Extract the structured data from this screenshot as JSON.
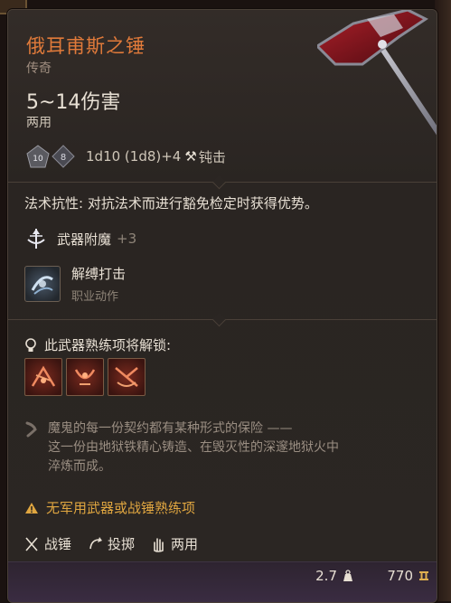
{
  "item": {
    "name": "俄耳甫斯之锤",
    "rarity": "传奇",
    "damage": "5~14伤害",
    "handedness": "两用",
    "dice": [
      "10",
      "8"
    ],
    "dice_formula": "1d10 (1d8)+4",
    "damage_type": "钝击"
  },
  "passive": {
    "label": "法术抗性:",
    "text": "对抗法术而进行豁免检定时获得优势。"
  },
  "enchantment": {
    "label": "武器附魔",
    "bonus": "+3"
  },
  "action": {
    "name": "解缚打击",
    "type": "职业动作"
  },
  "proficiency": {
    "title": "此武器熟练项将解锁:",
    "icons": [
      "proficiency-action-1-icon",
      "proficiency-action-2-icon",
      "proficiency-action-3-icon"
    ]
  },
  "flavor": {
    "line1": "魔鬼的每一份契约都有某种形式的保险 ——",
    "line2": "这一份由地狱铁精心铸造、在毁灭性的深邃地狱火中",
    "line3": "淬炼而成。"
  },
  "warning": "无军用武器或战锤熟练项",
  "properties": [
    {
      "icon": "warhammer-icon",
      "label": "战锤"
    },
    {
      "icon": "thrown-icon",
      "label": "投掷"
    },
    {
      "icon": "versatile-hand-icon",
      "label": "两用"
    }
  ],
  "footer": {
    "weight": "2.7",
    "value": "770"
  },
  "colors": {
    "legendary_title": "#e07a3a",
    "warning": "#e0a640",
    "panel_bg": "#2b2623"
  }
}
